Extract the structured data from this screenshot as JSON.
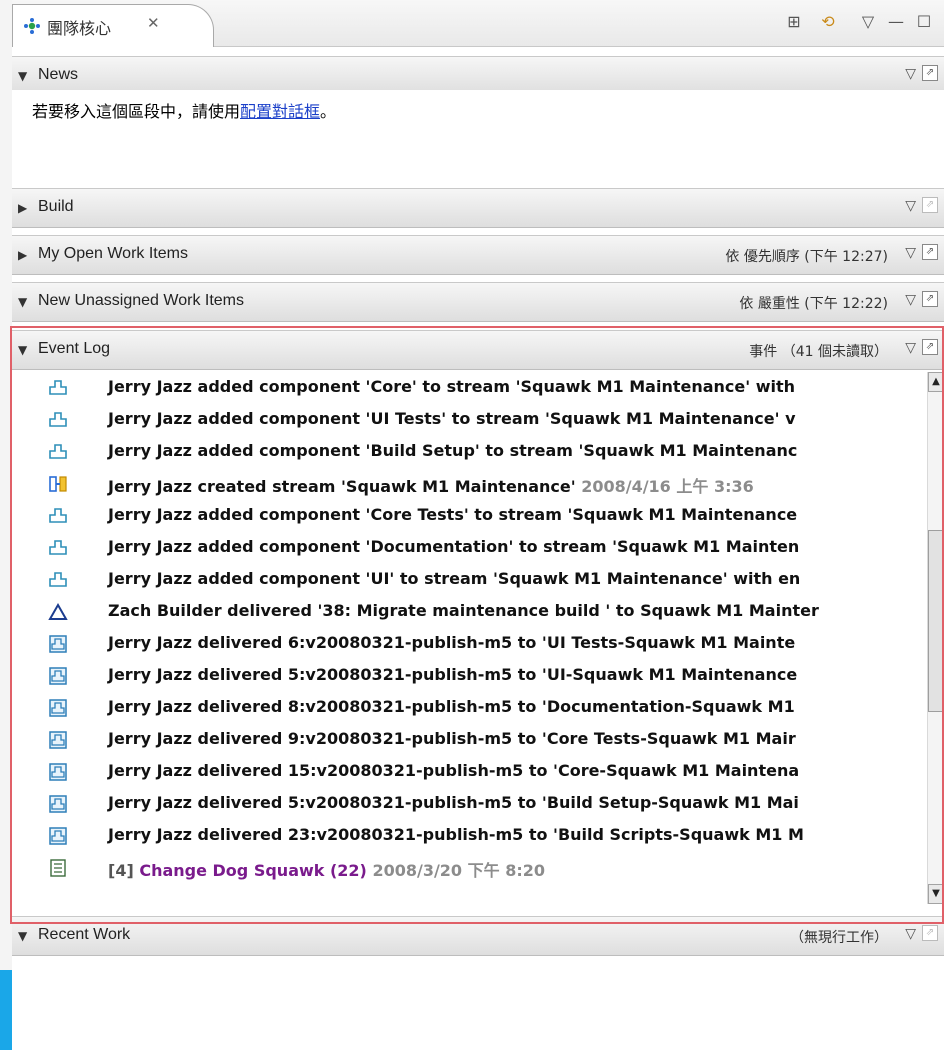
{
  "tab": {
    "title": "團隊核心",
    "close_glyph": "✕"
  },
  "toolbar": [
    "⊞",
    "⟲",
    "▽",
    "—",
    "☐"
  ],
  "sections": {
    "news": {
      "title": "News",
      "twisty": "▼",
      "body_prefix": "若要移入這個區段中，請使用",
      "link_text": "配置對話框",
      "body_suffix": "。"
    },
    "build": {
      "title": "Build",
      "twisty": "▶"
    },
    "open_items": {
      "title": "My Open Work Items",
      "twisty": "▶",
      "status": "依 優先順序 (下午 12:27)"
    },
    "unassigned": {
      "title": "New Unassigned Work Items",
      "twisty": "▼",
      "status": "依 嚴重性 (下午 12:22)"
    },
    "event_log": {
      "title": "Event Log",
      "twisty": "▼",
      "status": "事件 （41 個未讀取）"
    },
    "recent_work": {
      "title": "Recent Work",
      "twisty": "▼",
      "status": "（無現行工作）"
    }
  },
  "section_controls": {
    "menu": "▽",
    "maximize": "⇗"
  },
  "events": [
    {
      "icon": "component-icon",
      "text": "Jerry Jazz added component 'Core' to stream 'Squawk M1 Maintenance' with "
    },
    {
      "icon": "component-icon",
      "text": "Jerry Jazz added component 'UI Tests' to stream 'Squawk M1 Maintenance' v"
    },
    {
      "icon": "component-icon",
      "text": "Jerry Jazz added component 'Build Setup' to stream 'Squawk M1 Maintenanc"
    },
    {
      "icon": "stream-icon",
      "text": "Jerry Jazz created stream 'Squawk M1 Maintenance' ",
      "date": "2008/4/16 上午 3:36"
    },
    {
      "icon": "component-icon",
      "text": "Jerry Jazz added component 'Core Tests' to stream 'Squawk M1 Maintenance"
    },
    {
      "icon": "component-icon",
      "text": "Jerry Jazz added component 'Documentation' to stream 'Squawk M1 Mainten"
    },
    {
      "icon": "component-icon",
      "text": "Jerry Jazz added component 'UI' to stream 'Squawk M1 Maintenance' with en"
    },
    {
      "icon": "delta-icon",
      "text": "Zach Builder delivered '38: Migrate maintenance build ' to Squawk M1 Mainter"
    },
    {
      "icon": "delivery-icon",
      "text": "Jerry Jazz delivered 6:v20080321-publish-m5 to 'UI Tests-Squawk M1 Mainte"
    },
    {
      "icon": "delivery-icon",
      "text": "Jerry Jazz delivered 5:v20080321-publish-m5 to 'UI-Squawk M1 Maintenance"
    },
    {
      "icon": "delivery-icon",
      "text": "Jerry Jazz delivered 8:v20080321-publish-m5 to 'Documentation-Squawk M1"
    },
    {
      "icon": "delivery-icon",
      "text": "Jerry Jazz delivered 9:v20080321-publish-m5 to 'Core Tests-Squawk M1 Mair"
    },
    {
      "icon": "delivery-icon",
      "text": "Jerry Jazz delivered 15:v20080321-publish-m5 to 'Core-Squawk M1 Maintena"
    },
    {
      "icon": "delivery-icon",
      "text": "Jerry Jazz delivered 5:v20080321-publish-m5 to 'Build Setup-Squawk M1 Mai"
    },
    {
      "icon": "delivery-icon",
      "text": "Jerry Jazz delivered 23:v20080321-publish-m5 to 'Build Scripts-Squawk M1 M"
    },
    {
      "icon": "workitem-icon",
      "prefix": "[4] ",
      "text": "Change Dog Squawk (22)",
      "date": " 2008/3/20 下午 8:20"
    }
  ],
  "colors": {
    "highlight": "#e06068",
    "link": "#1a3fc9",
    "workitem": "#7a1b8c",
    "date": "#8c8c8c"
  }
}
